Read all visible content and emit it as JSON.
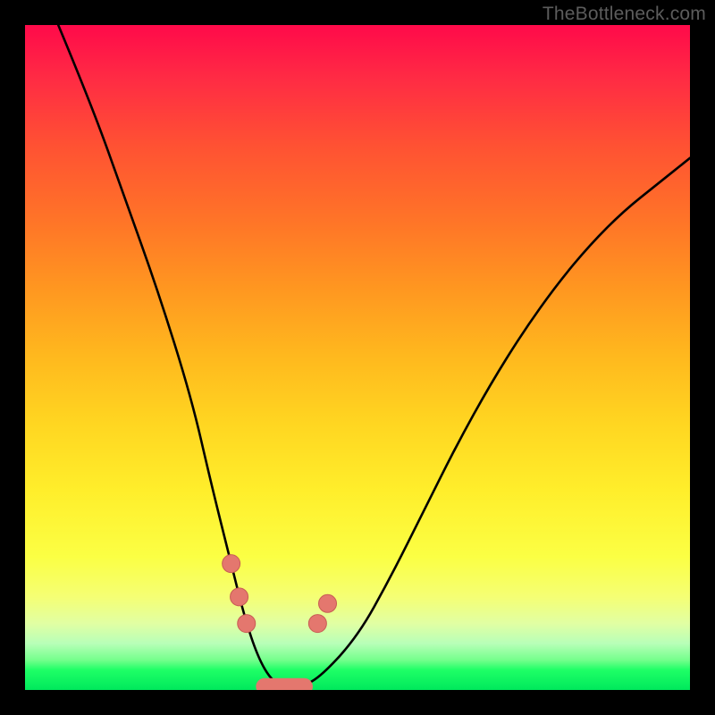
{
  "watermark": "TheBottleneck.com",
  "colors": {
    "frame": "#000000",
    "curve_stroke": "#000000",
    "marker_fill": "#e4776e",
    "marker_stroke": "#c85c54"
  },
  "gradient_stops": [
    {
      "offset": 0.0,
      "color": "#ff0a4a"
    },
    {
      "offset": 0.08,
      "color": "#ff2b44"
    },
    {
      "offset": 0.18,
      "color": "#ff5133"
    },
    {
      "offset": 0.3,
      "color": "#ff7627"
    },
    {
      "offset": 0.4,
      "color": "#ff9820"
    },
    {
      "offset": 0.5,
      "color": "#ffb91e"
    },
    {
      "offset": 0.6,
      "color": "#ffd621"
    },
    {
      "offset": 0.7,
      "color": "#ffee2b"
    },
    {
      "offset": 0.8,
      "color": "#fbff44"
    },
    {
      "offset": 0.86,
      "color": "#f5ff74"
    },
    {
      "offset": 0.9,
      "color": "#e1ffa3"
    },
    {
      "offset": 0.93,
      "color": "#b8ffb8"
    },
    {
      "offset": 0.955,
      "color": "#74ff8c"
    },
    {
      "offset": 0.97,
      "color": "#1eff66"
    },
    {
      "offset": 1.0,
      "color": "#00e85c"
    }
  ],
  "chart_data": {
    "type": "line",
    "title": "",
    "xlabel": "",
    "ylabel": "",
    "xlim": [
      0,
      100
    ],
    "ylim": [
      0,
      100
    ],
    "series": [
      {
        "name": "bottleneck-curve",
        "x": [
          5,
          10,
          15,
          20,
          25,
          28,
          31,
          33,
          35,
          37,
          39,
          41,
          44,
          50,
          55,
          60,
          65,
          70,
          75,
          80,
          85,
          90,
          95,
          100
        ],
        "y": [
          100,
          88,
          74,
          60,
          44,
          31,
          19,
          11,
          5,
          1.5,
          0.5,
          0.5,
          1.5,
          8,
          17,
          27,
          37,
          46,
          54,
          61,
          67,
          72,
          76,
          80
        ]
      }
    ],
    "markers": [
      {
        "x": 31.0,
        "y": 19
      },
      {
        "x": 32.2,
        "y": 14
      },
      {
        "x": 33.3,
        "y": 10
      },
      {
        "x": 44.0,
        "y": 10
      },
      {
        "x": 45.5,
        "y": 13
      }
    ],
    "flat_bottom": {
      "x_start": 36,
      "x_end": 42,
      "y": 0.5
    }
  }
}
